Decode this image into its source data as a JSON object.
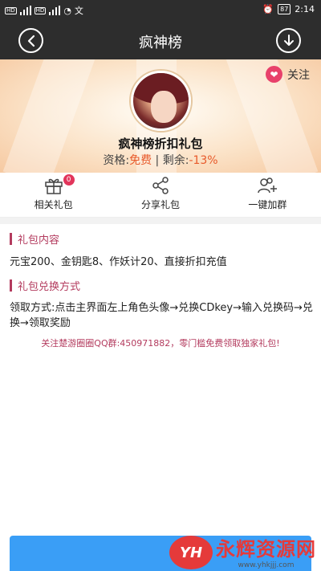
{
  "status_bar": {
    "left_text": "文",
    "alarm": "⏰",
    "battery": "87",
    "time": "2:14"
  },
  "appbar": {
    "title": "疯神榜"
  },
  "hero": {
    "follow_label": "关注",
    "gift_name": "疯神榜折扣礼包",
    "qualification_label": "资格:",
    "qualification_value": "免费",
    "separator": " | ",
    "remaining_label": "剩余:",
    "remaining_value": "-13%",
    "accent_color": "#e85a2b"
  },
  "actions": [
    {
      "label": "相关礼包",
      "icon": "gift-icon",
      "badge": "0"
    },
    {
      "label": "分享礼包",
      "icon": "share-icon"
    },
    {
      "label": "一键加群",
      "icon": "add-group-icon"
    }
  ],
  "sections": {
    "content_title": "礼包内容",
    "content_text": "元宝200、金钥匙8、作妖计20、直接折扣充值",
    "redeem_title": "礼包兑换方式",
    "redeem_text": "领取方式:点击主界面左上角色头像→兑换CDkey→输入兑换码→兑换→领取奖励",
    "promo_text": "关注楚游圈圈QQ群:450971882，零门槛免费领取独家礼包!"
  },
  "watermark": {
    "logo": "YH",
    "text": "永辉资源网",
    "url": "www.yhkjjj.com"
  }
}
